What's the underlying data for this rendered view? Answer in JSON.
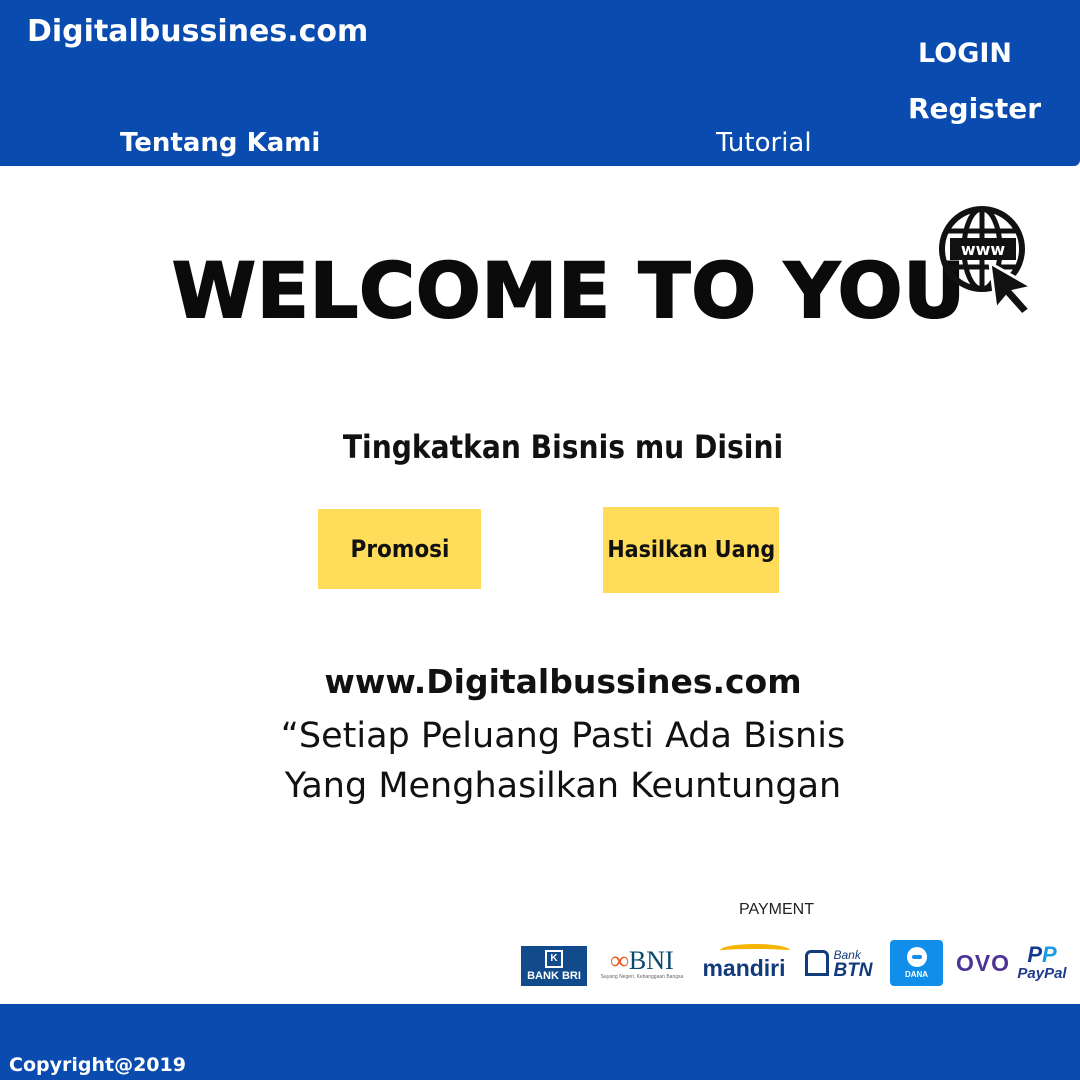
{
  "header": {
    "brand": "Digitalbussines.com",
    "nav": {
      "about": "Tentang Kami",
      "tutorial": "Tutorial",
      "login": "LOGIN",
      "register": "Register"
    },
    "color": "#0a4bb0"
  },
  "hero": {
    "title": "WELCOME TO YOU",
    "icon": "www-globe-cursor-icon",
    "icon_text": "www",
    "tagline": "Tingkatkan Bisnis mu Disini",
    "buttons": {
      "promosi": "Promosi",
      "hasilkan": "Hasilkan Uang"
    },
    "button_color": "#ffdc59"
  },
  "content": {
    "url": "www.Digitalbussines.com",
    "quote_line1": "“Setiap Peluang Pasti Ada Bisnis",
    "quote_line2": "Yang Menghasilkan Keuntungan"
  },
  "payment": {
    "label": "PAYMENT",
    "logos": {
      "bri": "BANK BRI",
      "bni": "BNI",
      "bni_small": "Sayang Negeri, Kebanggaan Bangsa",
      "mandiri": "mandiri",
      "btn_top": "Bank",
      "btn_main": "BTN",
      "dana": "DANA",
      "ovo": "OVO",
      "paypal": "PayPal"
    }
  },
  "footer": {
    "copyright": "Copyright@2019"
  }
}
